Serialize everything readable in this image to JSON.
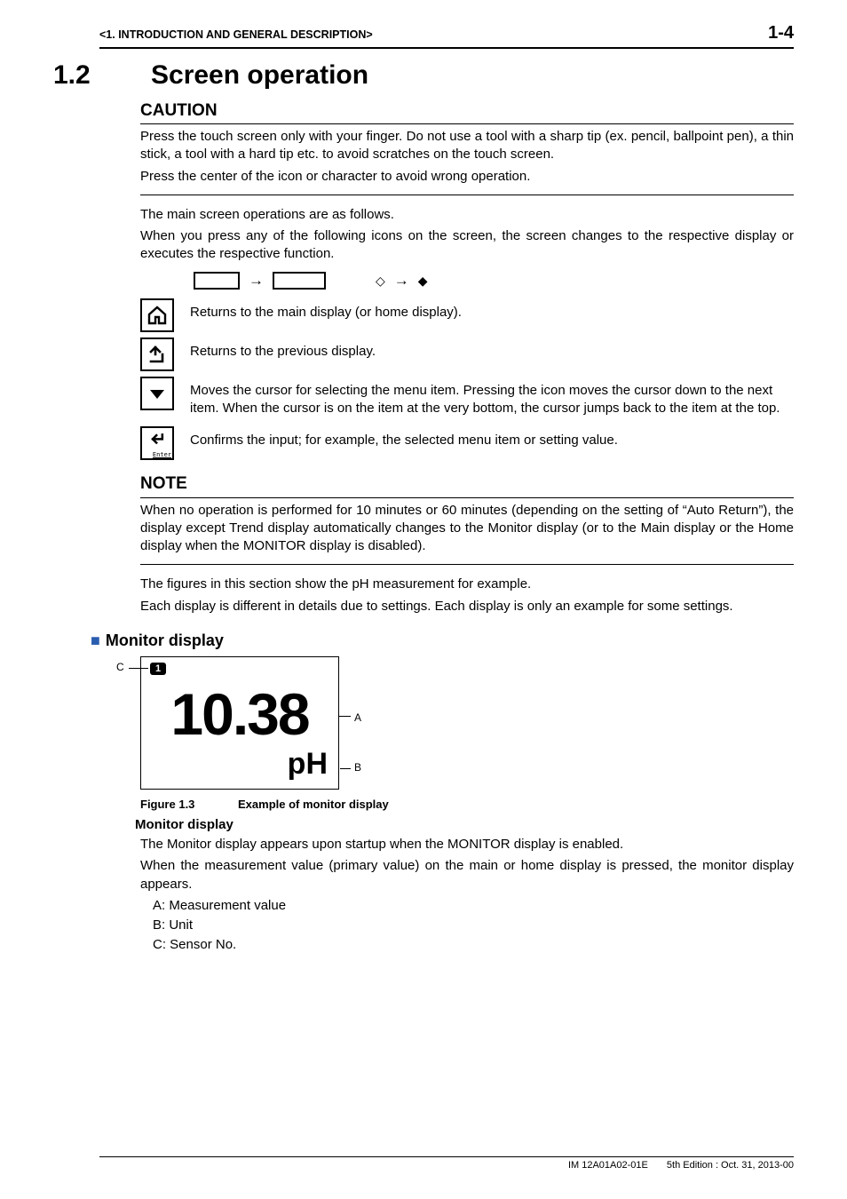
{
  "header": {
    "chapter_ref": "<1.  INTRODUCTION AND GENERAL DESCRIPTION>",
    "page_no": "1-4"
  },
  "section": {
    "number": "1.2",
    "title": "Screen operation"
  },
  "caution": {
    "heading": "CAUTION",
    "p1": "Press the touch screen only with your finger. Do not use a tool with a sharp tip (ex. pencil, ballpoint pen), a thin stick, a tool with a hard tip etc. to avoid scratches on the touch screen.",
    "p2": "Press the center of the icon or character to avoid wrong operation."
  },
  "intro": {
    "p1": "The main screen operations are as follows.",
    "p2": "When you press any of the following icons on the screen, the screen changes to the respective display or executes the respective function."
  },
  "icons": {
    "home": "Returns to the main display (or home display).",
    "back": "Returns to the previous display.",
    "down": "Moves the cursor for selecting the menu item. Pressing the icon moves the cursor down to the next item. When the cursor is on the item at the very bottom, the cursor jumps back to the item at the top.",
    "enter": "Confirms the input; for example, the selected menu item or setting value.",
    "enter_label": "Enter"
  },
  "note": {
    "heading": "NOTE",
    "p1": "When no operation is performed for 10 minutes or 60 minutes (depending on the setting of “Auto Return”), the display except Trend display automatically changes to the Monitor display (or to the Main display or the Home display when the MONITOR display is disabled)."
  },
  "after_note": {
    "p1": "The figures in this section show the pH measurement for example.",
    "p2": "Each display is different in details due to settings. Each display is only an example for some settings."
  },
  "monitor": {
    "heading": "Monitor display",
    "c_label": "C",
    "a_label": "A",
    "b_label": "B",
    "sensor_no": "1",
    "value": "10.38",
    "unit": "pH",
    "fig_no": "Figure 1.3",
    "fig_caption": "Example of monitor display",
    "sub_heading": "Monitor display",
    "p1": "The Monitor display appears upon startup when the MONITOR display is enabled.",
    "p2": "When the measurement value (primary value) on the main or home display is pressed, the monitor display appears.",
    "legend_a": "A:  Measurement value",
    "legend_b": "B:  Unit",
    "legend_c": "C:  Sensor No."
  },
  "footer": {
    "docid": "IM 12A01A02-01E",
    "edition": "5th Edition : Oct. 31, 2013-00"
  },
  "chart_data": {
    "type": "table",
    "title": "Example of monitor display",
    "labels": {
      "A": "Measurement value",
      "B": "Unit",
      "C": "Sensor No."
    },
    "values": {
      "A": 10.38,
      "B": "pH",
      "C": 1
    }
  }
}
